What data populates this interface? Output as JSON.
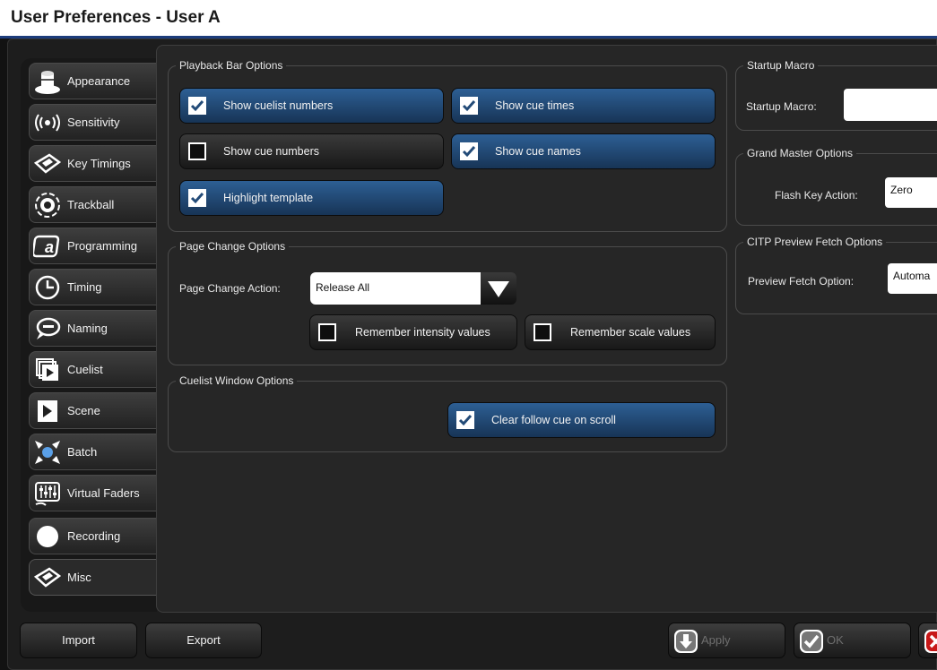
{
  "window": {
    "title": "User Preferences - User A"
  },
  "sidebar": {
    "items": [
      {
        "label": "Appearance",
        "icon": "appearance-icon"
      },
      {
        "label": "Sensitivity",
        "icon": "sensitivity-icon"
      },
      {
        "label": "Key Timings",
        "icon": "key-timings-icon"
      },
      {
        "label": "Trackball",
        "icon": "trackball-icon"
      },
      {
        "label": "Programming",
        "icon": "programming-icon"
      },
      {
        "label": "Timing",
        "icon": "clock-icon"
      },
      {
        "label": "Naming",
        "icon": "speech-bubble-icon"
      },
      {
        "label": "Cuelist",
        "icon": "cuelist-icon"
      },
      {
        "label": "Scene",
        "icon": "scene-icon"
      },
      {
        "label": "Batch",
        "icon": "batch-icon"
      },
      {
        "label": "Virtual Faders",
        "icon": "virtual-faders-icon"
      },
      {
        "label": "Recording",
        "icon": "recording-icon"
      },
      {
        "label": "Misc",
        "icon": "misc-icon"
      }
    ],
    "active": "Misc"
  },
  "playback": {
    "title": "Playback Bar Options",
    "show_cuelist_numbers": {
      "label": "Show cuelist numbers",
      "checked": true
    },
    "show_cue_times": {
      "label": "Show cue times",
      "checked": true
    },
    "show_cue_numbers": {
      "label": "Show cue numbers",
      "checked": false
    },
    "show_cue_names": {
      "label": "Show cue names",
      "checked": true
    },
    "highlight_template": {
      "label": "Highlight template",
      "checked": true
    }
  },
  "page_change": {
    "title": "Page Change Options",
    "action_label": "Page Change Action:",
    "action_value": "Release All",
    "remember_intensity": {
      "label": "Remember intensity values",
      "checked": false
    },
    "remember_scale": {
      "label": "Remember scale values",
      "checked": false
    }
  },
  "cuelist_window": {
    "title": "Cuelist Window Options",
    "clear_follow": {
      "label": "Clear follow cue on scroll",
      "checked": true
    }
  },
  "startup_macro": {
    "title": "Startup Macro",
    "label": "Startup Macro:",
    "value": ""
  },
  "grand_master": {
    "title": "Grand Master Options",
    "label": "Flash Key Action:",
    "value": "Zero"
  },
  "citp": {
    "title": "CITP Preview Fetch Options",
    "label": "Preview Fetch Option:",
    "value": "Automa"
  },
  "footer": {
    "import_label": "Import",
    "export_label": "Export",
    "apply_label": "Apply",
    "ok_label": "OK"
  },
  "colors": {
    "accent_blue": "#234b78",
    "title_border": "#1d3d7c",
    "background": "#262626"
  }
}
